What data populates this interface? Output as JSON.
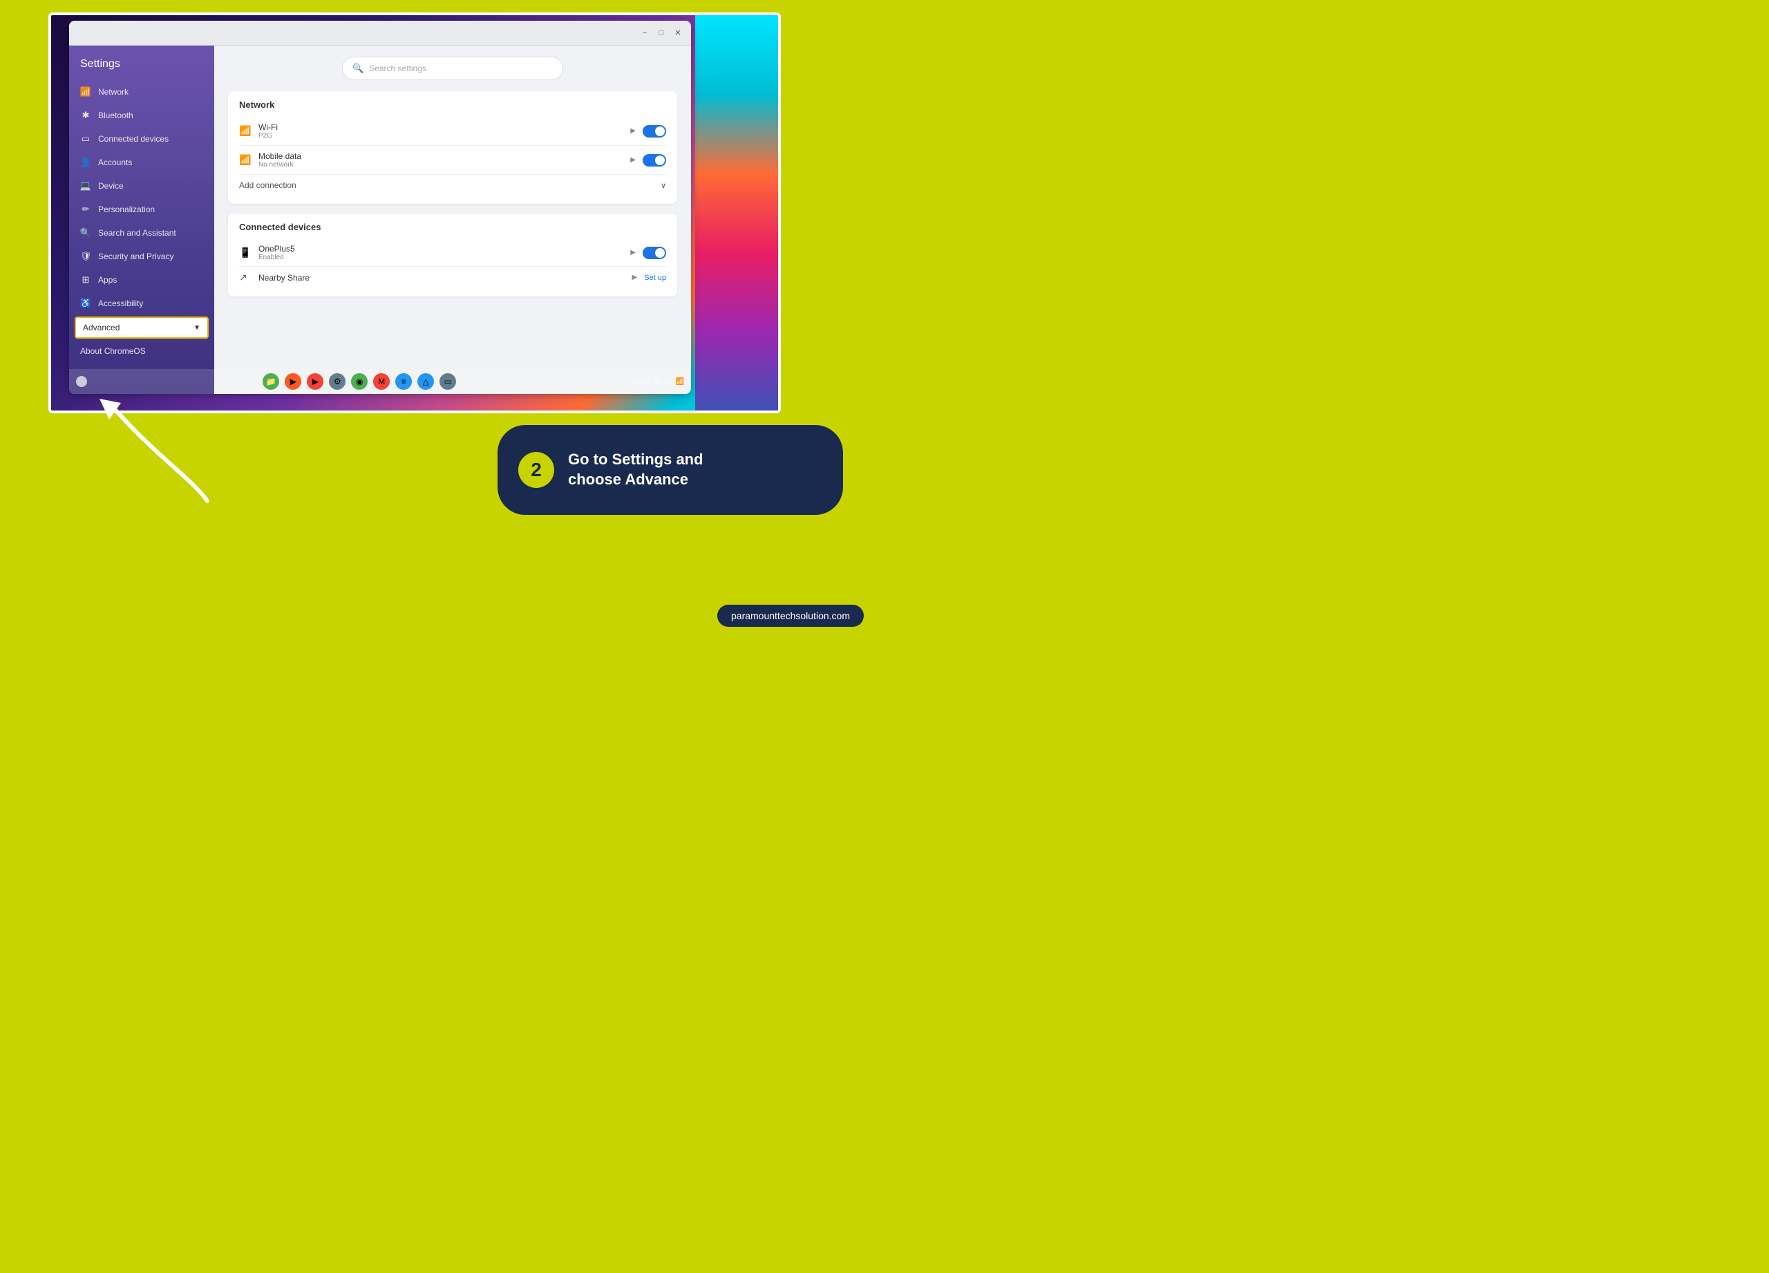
{
  "page": {
    "bg_color": "#c8d400"
  },
  "titlebar": {
    "minimize": "−",
    "maximize": "□",
    "close": "✕"
  },
  "settings": {
    "title": "Settings",
    "search_placeholder": "Search settings"
  },
  "sidebar": {
    "items": [
      {
        "id": "network",
        "label": "Network",
        "icon": "📶"
      },
      {
        "id": "bluetooth",
        "label": "Bluetooth",
        "icon": "🔵"
      },
      {
        "id": "connected-devices",
        "label": "Connected devices",
        "icon": "📱"
      },
      {
        "id": "accounts",
        "label": "Accounts",
        "icon": "👤"
      },
      {
        "id": "device",
        "label": "Device",
        "icon": "💻"
      },
      {
        "id": "personalization",
        "label": "Personalization",
        "icon": "🎨"
      },
      {
        "id": "search-assistant",
        "label": "Search and Assistant",
        "icon": "🔍"
      },
      {
        "id": "security-privacy",
        "label": "Security and Privacy",
        "icon": "🛡"
      },
      {
        "id": "apps",
        "label": "Apps",
        "icon": "⊞"
      },
      {
        "id": "accessibility",
        "label": "Accessibility",
        "icon": "♿"
      },
      {
        "id": "advanced",
        "label": "Advanced",
        "icon": "▼"
      },
      {
        "id": "about",
        "label": "About ChromeOS",
        "icon": ""
      }
    ]
  },
  "network_section": {
    "title": "Network",
    "wifi": {
      "name": "Wi-Fi",
      "sub": "P2G",
      "enabled": true
    },
    "mobile": {
      "name": "Mobile data",
      "sub": "No network",
      "enabled": true
    },
    "add_connection": "Add connection"
  },
  "connected_section": {
    "title": "Connected devices",
    "devices": [
      {
        "name": "OnePlus5",
        "sub": "Enabled",
        "enabled": true
      },
      {
        "name": "Nearby Share",
        "sub": "",
        "setup": "Set up"
      }
    ]
  },
  "taskbar": {
    "time": "11:10",
    "date": "Jul 29"
  },
  "instruction": {
    "step": "2",
    "text": "Go to Settings and\nchoose Advance"
  },
  "website": {
    "url": "paramounttechsolution.com"
  }
}
